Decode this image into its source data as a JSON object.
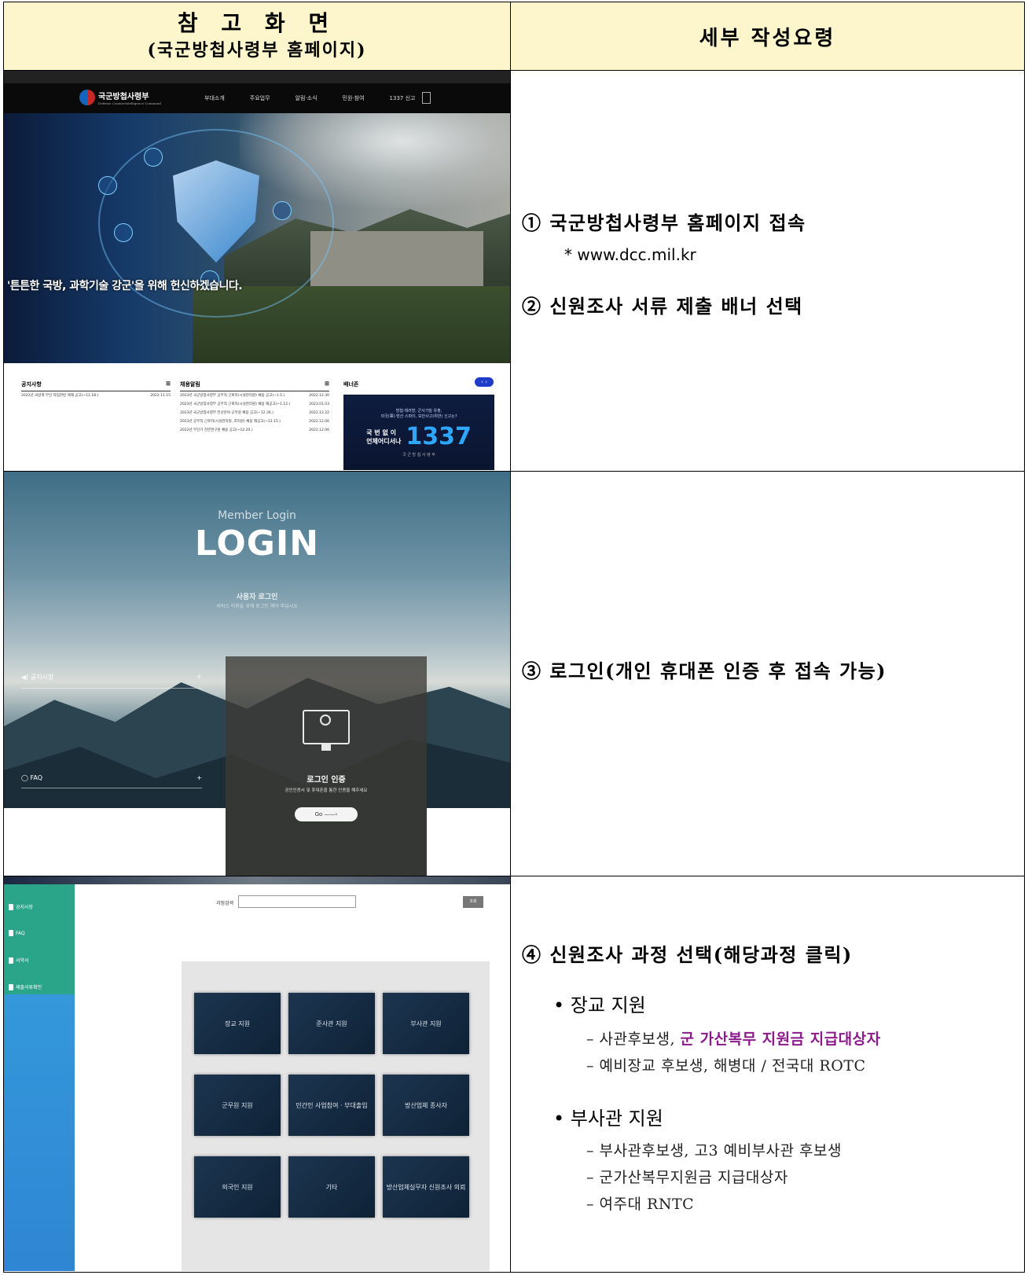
{
  "header": {
    "left_title": "참 고 화 면",
    "left_subtitle": "(국군방첩사령부 홈페이지)",
    "right_title": "세부 작성요령"
  },
  "screen1": {
    "site_name": "국군방첩사령부",
    "site_name_en": "Defense Counterintelligence Command",
    "nav_items": [
      "부대소개",
      "주요업무",
      "알림·소식",
      "민원·참여",
      "1337 신고"
    ],
    "slogan": "'튼튼한 국방, 과학기술 강군'을 위해 헌신하겠습니다.",
    "notice_title": "공지사항",
    "notice_rows": [
      {
        "text": "2022년 국방개 부인 작업관련 제재 공고(~12.18.)",
        "date": "2022.11.15"
      }
    ],
    "recruit_title": "채용알림",
    "recruit_rows": [
      {
        "text": "2023년 국군방첩사령부 공무직 근로자(시설관리원) 채용 공고(~1.5.)",
        "date": "2022.12.30"
      },
      {
        "text": "2023년 국군방첩사령부 공무직 근로자(시설관리원) 채용 재공고(~1.12.)",
        "date": "2023.01.03"
      },
      {
        "text": "2023년 국군방첩사령부 전산분야 군무원 채용 공고(~12.30.)",
        "date": "2022.12.22"
      },
      {
        "text": "2023년 공무직 근로자(시설관리원, 조리원) 채용 재공고(~12.15.)",
        "date": "2022.12.06"
      },
      {
        "text": "2022년 무인기 전문연구원 채용 공고(~12.20.)",
        "date": "2022.12.06"
      }
    ],
    "banner_title": "배너존",
    "banner_line1": "방첩·테러방, 군사기밀 유출,",
    "banner_line2": "외국(軍)·방산 스파이, 보안사고(위반) 신고는?",
    "banner_k1": "국 번 없 이",
    "banner_k2": "언제어디서나",
    "banner_number": "1337",
    "banner_org": "국 군 방 첩 사 령 부"
  },
  "screen2": {
    "member_login": "Member Login",
    "login": "LOGIN",
    "user_login": "사용자 로그인",
    "user_login_desc": "서비스 이용을 위해 로그인 해야 주십시오",
    "side_notice": "공지사항",
    "side_faq": "FAQ",
    "plus": "+",
    "cert_title": "로그인 인증",
    "cert_desc": "공인인증서 및 휴대폰을 통한 인증을 해주세요",
    "go_button": "Go ——›"
  },
  "screen3": {
    "sidebar_items": [
      "공지사항",
      "FAQ",
      "서약서",
      "제출서류확인"
    ],
    "search_label": "과정검색",
    "search_button": "조회",
    "cards": [
      "장교 지원",
      "준사관 지원",
      "부사관 지원",
      "군무원 지원",
      "민간인 사업참여 · 부대출입",
      "방산업체 종사자",
      "외국인 지원",
      "기타",
      "방산업체실무자 신원조사 의뢰"
    ]
  },
  "steps": {
    "s1": "① 국군방첩사령부 홈페이지 접속",
    "s1_url": "* www.dcc.mil.kr",
    "s2": "② 신원조사 서류 제출 배너 선택",
    "s3": "③ 로그인(개인 휴대폰 인증 후 접속 가능)",
    "s4": "④ 신원조사 과정 선택(해당과정 클릭)",
    "b1": "장교 지원",
    "b1_l1_a": "– 사관후보생, ",
    "b1_l1_b": "군 가산복무 지원금 지급대상자",
    "b1_l2": "– 예비장교 후보생, 해병대 / 전국대 ROTC",
    "b2": "부사관 지원",
    "b2_l1": "– 부사관후보생, 고3 예비부사관 후보생",
    "b2_l2": "– 군가산복무지원금 지급대상자",
    "b2_l3": "– 여주대 RNTC"
  },
  "colors": {
    "header_bg": "#fdf6cc",
    "emphasis": "#8b1a8b",
    "sidebar_green": "#2aa58a",
    "sidebar_blue": "#3498db"
  }
}
